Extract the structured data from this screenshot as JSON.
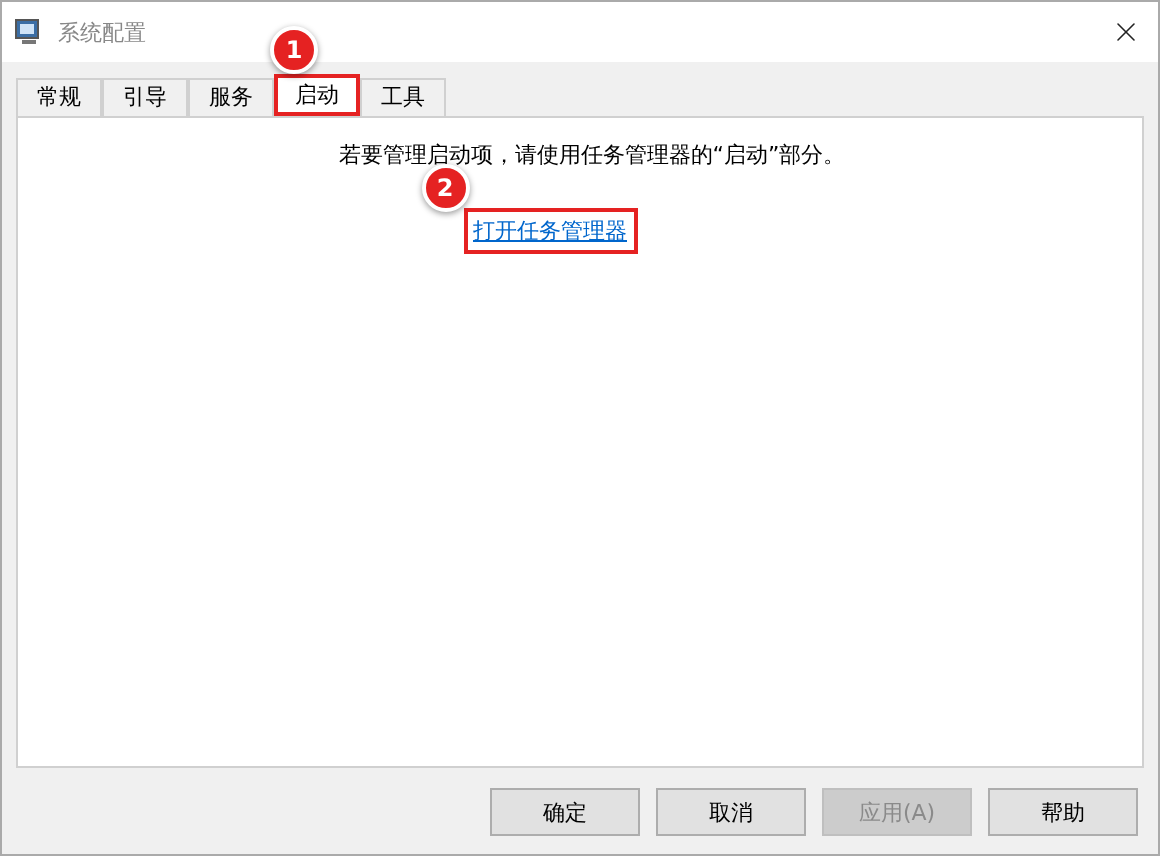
{
  "window": {
    "title": "系统配置"
  },
  "tabs": [
    {
      "label": "常规",
      "selected": false,
      "highlighted": false
    },
    {
      "label": "引导",
      "selected": false,
      "highlighted": false
    },
    {
      "label": "服务",
      "selected": false,
      "highlighted": false
    },
    {
      "label": "启动",
      "selected": true,
      "highlighted": true,
      "step": "1"
    },
    {
      "label": "工具",
      "selected": false,
      "highlighted": false
    }
  ],
  "message": "若要管理启动项，请使用任务管理器的“启动”部分。",
  "link": {
    "label": "打开任务管理器",
    "highlighted": true,
    "step": "2"
  },
  "buttons": [
    {
      "label": "确定",
      "disabled": false
    },
    {
      "label": "取消",
      "disabled": false
    },
    {
      "label": "应用(A)",
      "disabled": true
    },
    {
      "label": "帮助",
      "disabled": false
    }
  ]
}
